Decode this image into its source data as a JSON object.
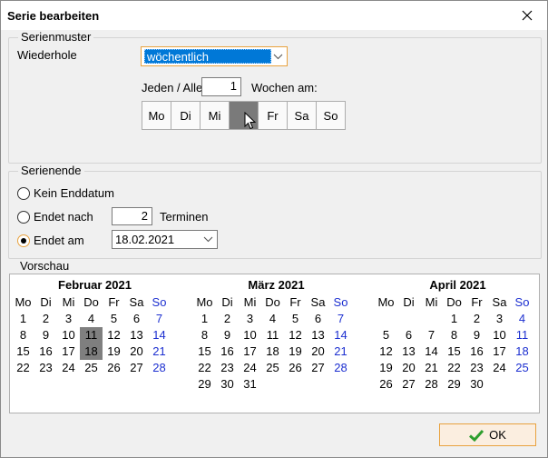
{
  "window": {
    "title": "Serie bearbeiten"
  },
  "serienmuster": {
    "legend": "Serienmuster",
    "repeat_label": "Wiederhole",
    "repeat_value": "wöchentlich",
    "every_label": "Jeden / Alle",
    "every_value": "1",
    "weeks_on_label": "Wochen am:",
    "days": [
      {
        "label": "Mo",
        "active": false
      },
      {
        "label": "Di",
        "active": false
      },
      {
        "label": "Mi",
        "active": false
      },
      {
        "label": "Do",
        "active": true
      },
      {
        "label": "Fr",
        "active": false
      },
      {
        "label": "Sa",
        "active": false
      },
      {
        "label": "So",
        "active": false
      }
    ]
  },
  "serienende": {
    "legend": "Serienende",
    "no_end_label": "Kein Enddatum",
    "ends_after_label": "Endet nach",
    "ends_after_value": "2",
    "appointments_label": "Terminen",
    "ends_on_label": "Endet am",
    "ends_on_value": "18.02.2021",
    "selected": "ends_on"
  },
  "vorschau": {
    "legend": "Vorschau",
    "weekday_headers": [
      "Mo",
      "Di",
      "Mi",
      "Do",
      "Fr",
      "Sa",
      "So"
    ],
    "months": [
      {
        "title": "Februar 2021",
        "weeks": [
          [
            "1",
            "2",
            "3",
            "4",
            "5",
            "6",
            "7"
          ],
          [
            "8",
            "9",
            "10",
            "11",
            "12",
            "13",
            "14"
          ],
          [
            "15",
            "16",
            "17",
            "18",
            "19",
            "20",
            "21"
          ],
          [
            "22",
            "23",
            "24",
            "25",
            "26",
            "27",
            "28"
          ]
        ],
        "marked": [
          "11",
          "18"
        ]
      },
      {
        "title": "März 2021",
        "weeks": [
          [
            "1",
            "2",
            "3",
            "4",
            "5",
            "6",
            "7"
          ],
          [
            "8",
            "9",
            "10",
            "11",
            "12",
            "13",
            "14"
          ],
          [
            "15",
            "16",
            "17",
            "18",
            "19",
            "20",
            "21"
          ],
          [
            "22",
            "23",
            "24",
            "25",
            "26",
            "27",
            "28"
          ],
          [
            "29",
            "30",
            "31",
            "",
            "",
            "",
            ""
          ]
        ],
        "marked": []
      },
      {
        "title": "April 2021",
        "weeks": [
          [
            "",
            "",
            "",
            "1",
            "2",
            "3",
            "4"
          ],
          [
            "5",
            "6",
            "7",
            "8",
            "9",
            "10",
            "11"
          ],
          [
            "12",
            "13",
            "14",
            "15",
            "16",
            "17",
            "18"
          ],
          [
            "19",
            "20",
            "21",
            "22",
            "23",
            "24",
            "25"
          ],
          [
            "26",
            "27",
            "28",
            "29",
            "30",
            "",
            ""
          ]
        ],
        "marked": []
      }
    ]
  },
  "footer": {
    "ok_label": "OK"
  },
  "colors": {
    "sunday": "#1c2fd0",
    "focus_border": "#e8a23f",
    "selection": "#0078d7",
    "marked_day": "#7f7f7f",
    "ok_check": "#2e9e2e"
  }
}
